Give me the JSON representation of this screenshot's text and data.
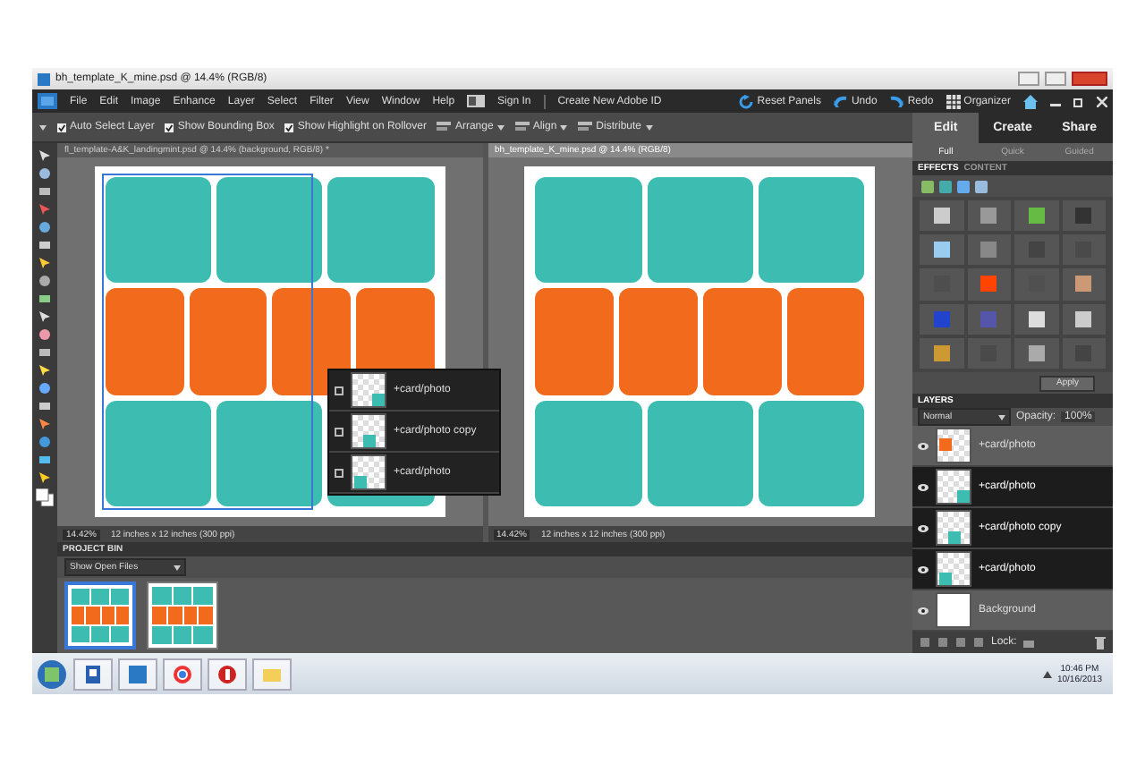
{
  "window": {
    "title": "bh_template_K_mine.psd @ 14.4% (RGB/8)"
  },
  "menu": [
    "File",
    "Edit",
    "Image",
    "Enhance",
    "Layer",
    "Select",
    "Filter",
    "View",
    "Window",
    "Help"
  ],
  "account": [
    "Sign In",
    "Create New Adobe ID"
  ],
  "actions": [
    {
      "label": "Reset Panels",
      "kind": "reset"
    },
    {
      "label": "Undo",
      "kind": "undo"
    },
    {
      "label": "Redo",
      "kind": "redo"
    },
    {
      "label": "Organizer",
      "kind": "organizer"
    }
  ],
  "options": [
    {
      "label": "Auto Select Layer",
      "kind": "check",
      "checked": true
    },
    {
      "label": "Show Bounding Box",
      "kind": "check",
      "checked": true
    },
    {
      "label": "Show Highlight on Rollover",
      "kind": "check",
      "checked": true
    },
    {
      "label": "Arrange",
      "kind": "menu"
    },
    {
      "label": "Align",
      "kind": "menu"
    },
    {
      "label": "Distribute",
      "kind": "menu"
    }
  ],
  "mode_tabs": [
    {
      "label": "Edit",
      "selected": true
    },
    {
      "label": "Create",
      "selected": false
    },
    {
      "label": "Share",
      "selected": false
    }
  ],
  "edit_tabs": [
    {
      "label": "Full",
      "selected": true
    },
    {
      "label": "Quick",
      "selected": false
    },
    {
      "label": "Guided",
      "selected": false
    }
  ],
  "documents": [
    {
      "title": "fl_template-A&K_landingmint.psd @ 14.4% (background, RGB/8) *",
      "selected": false,
      "selection": true,
      "zoom": "14.42%",
      "size": "12 inches x 12 inches (300 ppi)"
    },
    {
      "title": "bh_template_K_mine.psd @ 14.4% (RGB/8)",
      "selected": true,
      "selection": false,
      "zoom": "14.42%",
      "size": "12 inches x 12 inches (300 ppi)"
    }
  ],
  "layer_popup": [
    {
      "name": "+card/photo",
      "kind": "right"
    },
    {
      "name": "+card/photo copy",
      "kind": "middle"
    },
    {
      "name": "+card/photo",
      "kind": "left"
    }
  ],
  "effects": {
    "tabs": [
      {
        "label": "EFFECTS",
        "selected": true
      },
      {
        "label": "CONTENT",
        "selected": false
      }
    ],
    "button": "Apply"
  },
  "layers": {
    "title": "LAYERS",
    "blend": "Normal",
    "opacity_label": "Opacity:",
    "opacity": "100%",
    "lock": "Lock:",
    "items": [
      {
        "name": "+card/photo",
        "kind": "orange",
        "selected": false
      },
      {
        "name": "+card/photo",
        "kind": "right",
        "selected": true
      },
      {
        "name": "+card/photo copy",
        "kind": "middle",
        "selected": true
      },
      {
        "name": "+card/photo",
        "kind": "left",
        "selected": true
      },
      {
        "name": "Background",
        "kind": "blank",
        "selected": false
      }
    ]
  },
  "project_bin": {
    "title": "PROJECT BIN",
    "filter": "Show Open Files",
    "thumbs": [
      {
        "selected": true
      },
      {
        "selected": false
      }
    ]
  },
  "taskbar": {
    "time": "10:46 PM",
    "date": "10/16/2013"
  }
}
